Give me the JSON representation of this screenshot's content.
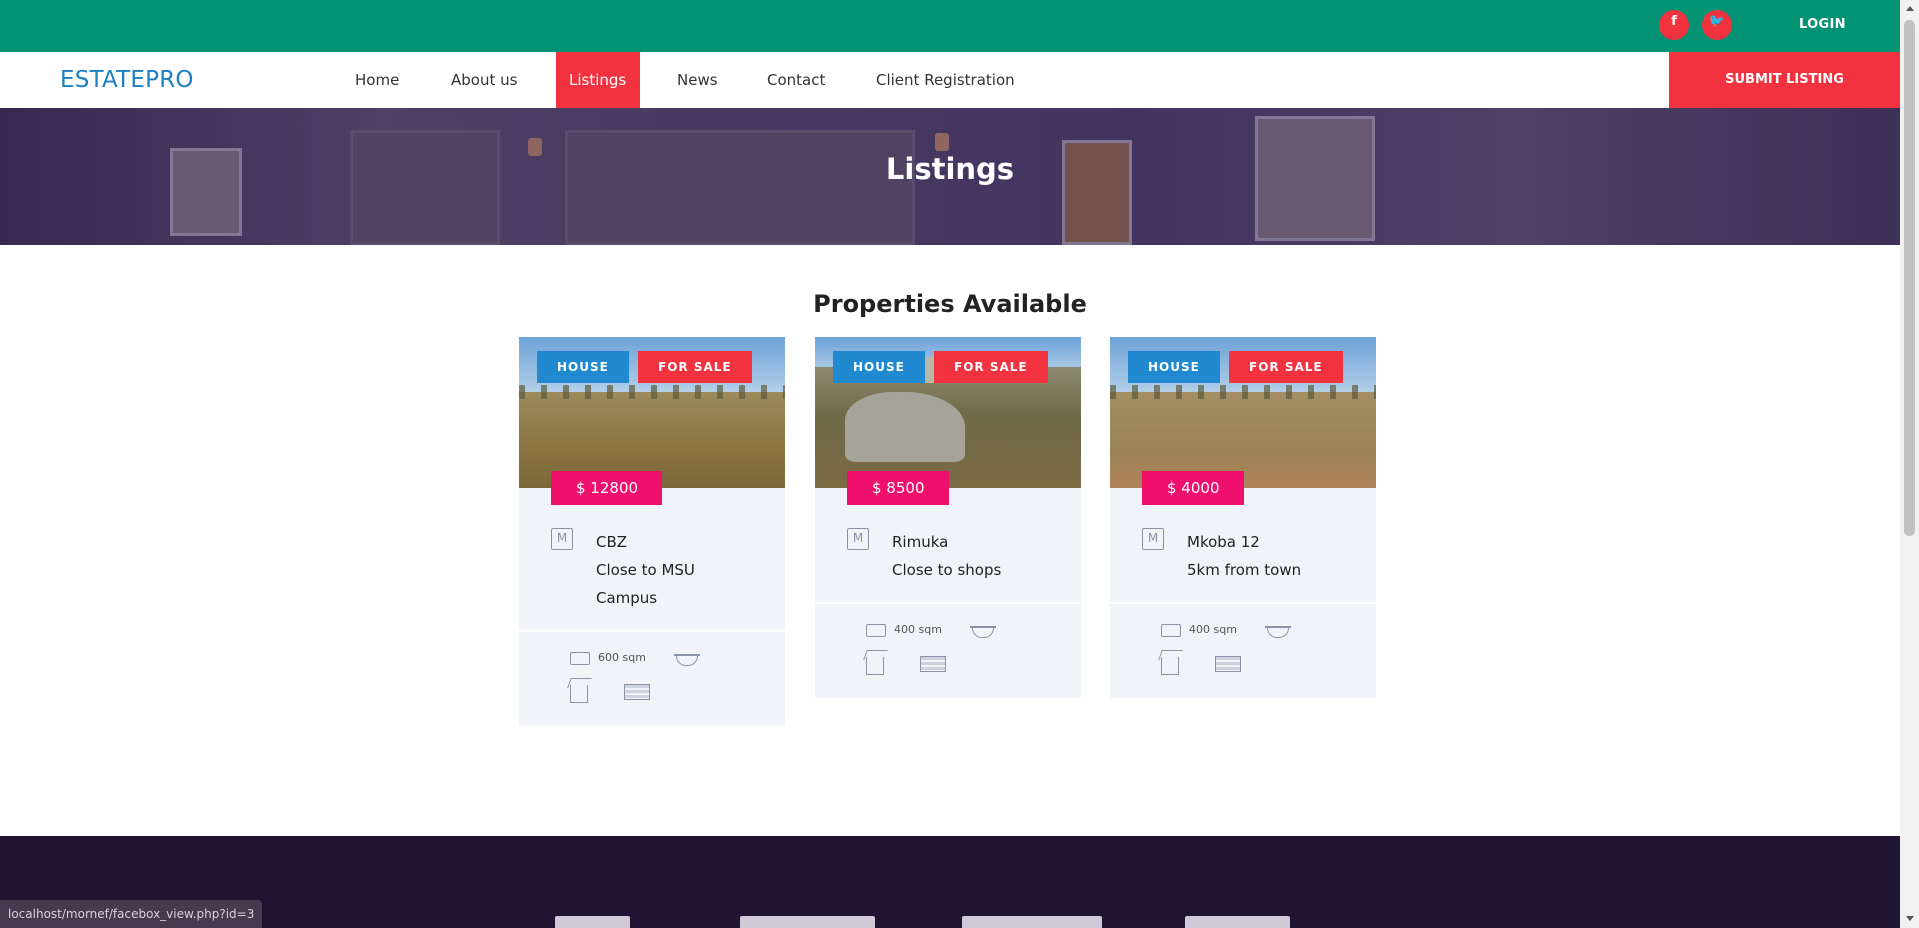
{
  "topbar": {
    "facebook_glyph": "f",
    "twitter_glyph": "🐦",
    "login": "LOGIN"
  },
  "navbar": {
    "logo": "ESTATEPRO",
    "items": [
      {
        "label": "Home"
      },
      {
        "label": "About us"
      },
      {
        "label": "Listings"
      },
      {
        "label": "News"
      },
      {
        "label": "Contact"
      },
      {
        "label": "Client Registration"
      }
    ],
    "active": "Listings",
    "submit": "SUBMIT LISTING"
  },
  "hero": {
    "title": "Listings"
  },
  "section": {
    "title": "Properties Available"
  },
  "listings": [
    {
      "type": "HOUSE",
      "status": "FOR SALE",
      "price": "$ 12800",
      "lines": [
        "CBZ",
        "Close to MSU",
        "Campus"
      ],
      "area": "600 sqm"
    },
    {
      "type": "HOUSE",
      "status": "FOR SALE",
      "price": "$ 8500",
      "lines": [
        "Rimuka",
        "Close to shops"
      ],
      "area": "400 sqm"
    },
    {
      "type": "HOUSE",
      "status": "FOR SALE",
      "price": "$ 4000",
      "lines": [
        "Mkoba 12",
        "5km from town"
      ],
      "area": "400 sqm"
    }
  ],
  "status_bar": {
    "url": "localhost/mornef/facebox_view.php?id=3"
  },
  "colors": {
    "topbar": "#019373",
    "accent_red": "#f2323f",
    "logo_blue": "#1b7fc4",
    "house_tag": "#2189d0",
    "price_tag": "#ef0f6c",
    "footer": "#1f1431"
  }
}
